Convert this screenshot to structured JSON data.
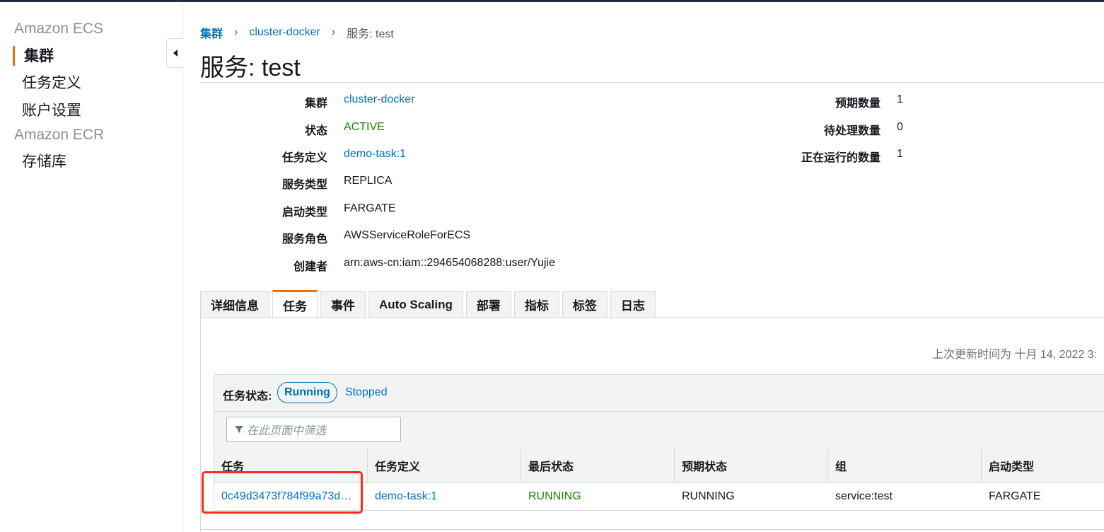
{
  "sidebar": {
    "sections": [
      {
        "title": "Amazon ECS",
        "items": [
          "集群",
          "任务定义",
          "账户设置"
        ]
      },
      {
        "title": "Amazon ECR",
        "items": [
          "存储库"
        ]
      }
    ]
  },
  "breadcrumb": {
    "root": "集群",
    "cluster": "cluster-docker",
    "current": "服务: test"
  },
  "page_title": "服务: test",
  "details": {
    "left": [
      {
        "label": "集群",
        "value": "cluster-docker"
      },
      {
        "label": "状态",
        "value": "ACTIVE"
      },
      {
        "label": "任务定义",
        "value": "demo-task:1"
      },
      {
        "label": "服务类型",
        "value": "REPLICA"
      },
      {
        "label": "启动类型",
        "value": "FARGATE"
      },
      {
        "label": "服务角色",
        "value": "AWSServiceRoleForECS"
      },
      {
        "label": "创建者",
        "value": "arn:aws-cn:iam::294654068288:user/Yujie"
      }
    ],
    "right": [
      {
        "label": "预期数量",
        "value": "1"
      },
      {
        "label": "待处理数量",
        "value": "0"
      },
      {
        "label": "正在运行的数量",
        "value": "1"
      }
    ]
  },
  "tabs": [
    "详细信息",
    "任务",
    "事件",
    "Auto Scaling",
    "部署",
    "指标",
    "标签",
    "日志"
  ],
  "active_tab": "任务",
  "last_updated": "上次更新时间为 十月 14, 2022 3:",
  "task_filter": {
    "label": "任务状态:",
    "running": "Running",
    "stopped": "Stopped"
  },
  "filter_placeholder": "在此页面中筛选",
  "table": {
    "columns": [
      "任务",
      "任务定义",
      "最后状态",
      "预期状态",
      "组",
      "启动类型"
    ],
    "rows": [
      {
        "task": "0c49d3473f784f99a73d…",
        "task_def": "demo-task:1",
        "last_status": "RUNNING",
        "desired_status": "RUNNING",
        "group": "service:test",
        "launch_type": "FARGATE"
      }
    ]
  },
  "colors": {
    "accent": "#ec7211",
    "link": "#0073bb",
    "success": "#1d8102",
    "highlight": "#ff2a1f"
  }
}
